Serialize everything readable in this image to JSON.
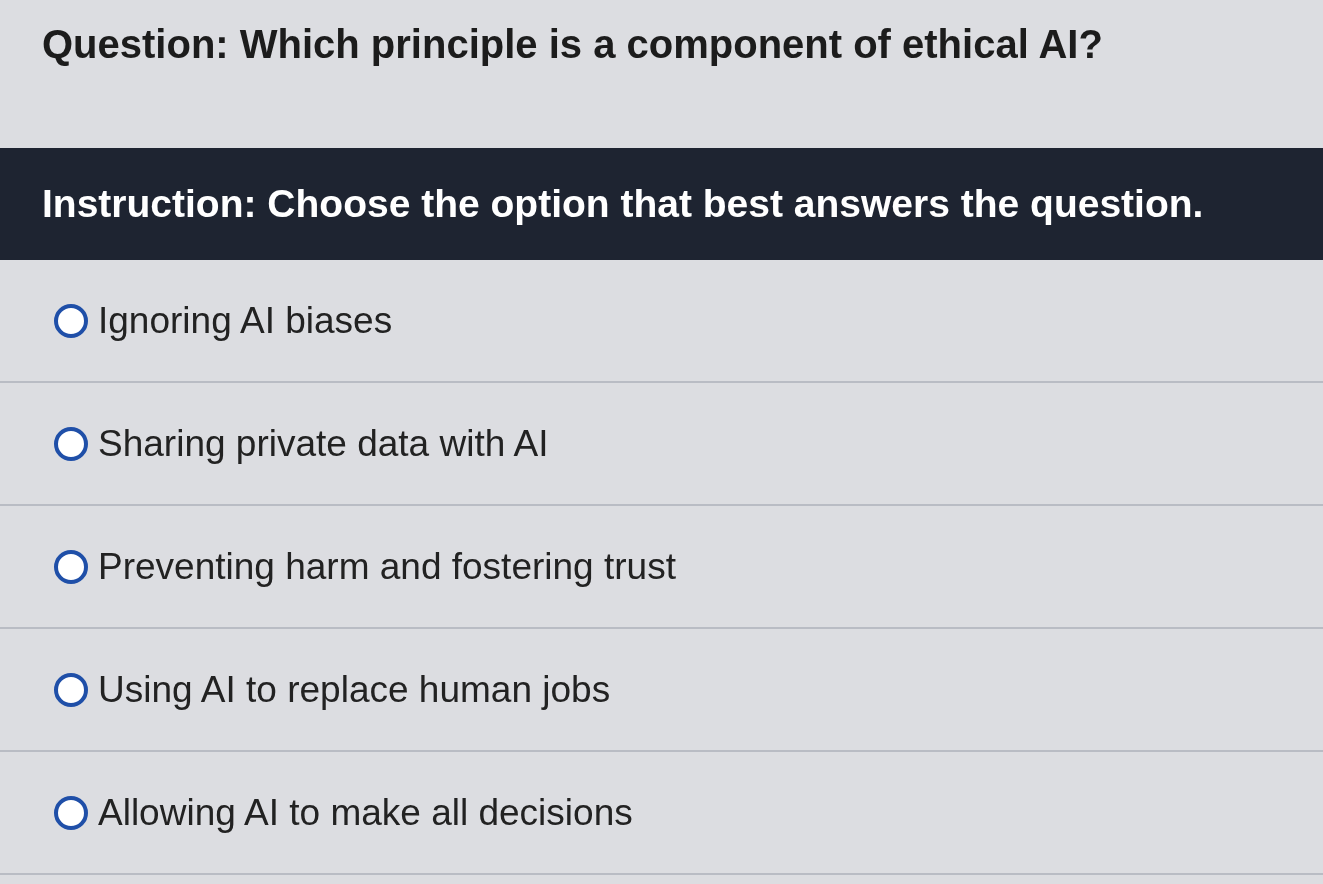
{
  "question": "Question: Which principle is a component of ethical AI?",
  "instruction": "Instruction: Choose the option that best answers the question.",
  "options": [
    {
      "label": "Ignoring AI biases",
      "selected": false
    },
    {
      "label": "Sharing private data with AI",
      "selected": false
    },
    {
      "label": "Preventing harm and fostering trust",
      "selected": false
    },
    {
      "label": "Using AI to replace human jobs",
      "selected": false
    },
    {
      "label": "Allowing AI to make all decisions",
      "selected": false
    }
  ]
}
